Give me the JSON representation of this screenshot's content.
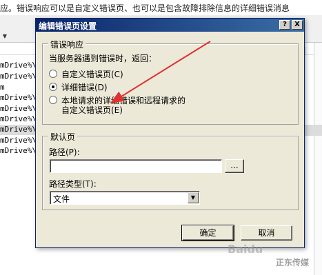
{
  "background": {
    "description_text": "应。错误响应可以是自定义错误页、也可以是包含故障排除信息的详细错误消息",
    "toolbar_dropdown": "▼",
    "rows": [
      "mDrive%\\",
      "mDrive%\\",
      "m",
      "mDrive%\\",
      "mDrive%\\",
      "mDrive%\\",
      "mDrive%\\",
      "mDrive%\\",
      "mDrive%\\"
    ],
    "selected_row_index": 5
  },
  "dialog": {
    "title": "编辑错误页设置",
    "help_button": "?",
    "close_button": "X",
    "error_response": {
      "legend": "错误响应",
      "prompt": "当服务器遇到错误时，返回：",
      "options": [
        {
          "label": "自定义错误页(C)",
          "selected": false
        },
        {
          "label": "详细错误(D)",
          "selected": true
        },
        {
          "label": "本地请求的详细错误和远程请求的",
          "label_line2": "自定义错误页(E)",
          "selected": false
        }
      ]
    },
    "default_page": {
      "legend": "默认页",
      "path_label": "路径(P):",
      "path_value": "",
      "browse_button": "...",
      "path_type_label": "路径类型(T):",
      "path_type_value": "文件"
    },
    "ok_button": "确定",
    "cancel_button": "取消"
  },
  "annotation": {
    "arrow_color": "#e03030"
  },
  "watermarks": {
    "baidu": "Baidu",
    "right": "正东传媒"
  }
}
